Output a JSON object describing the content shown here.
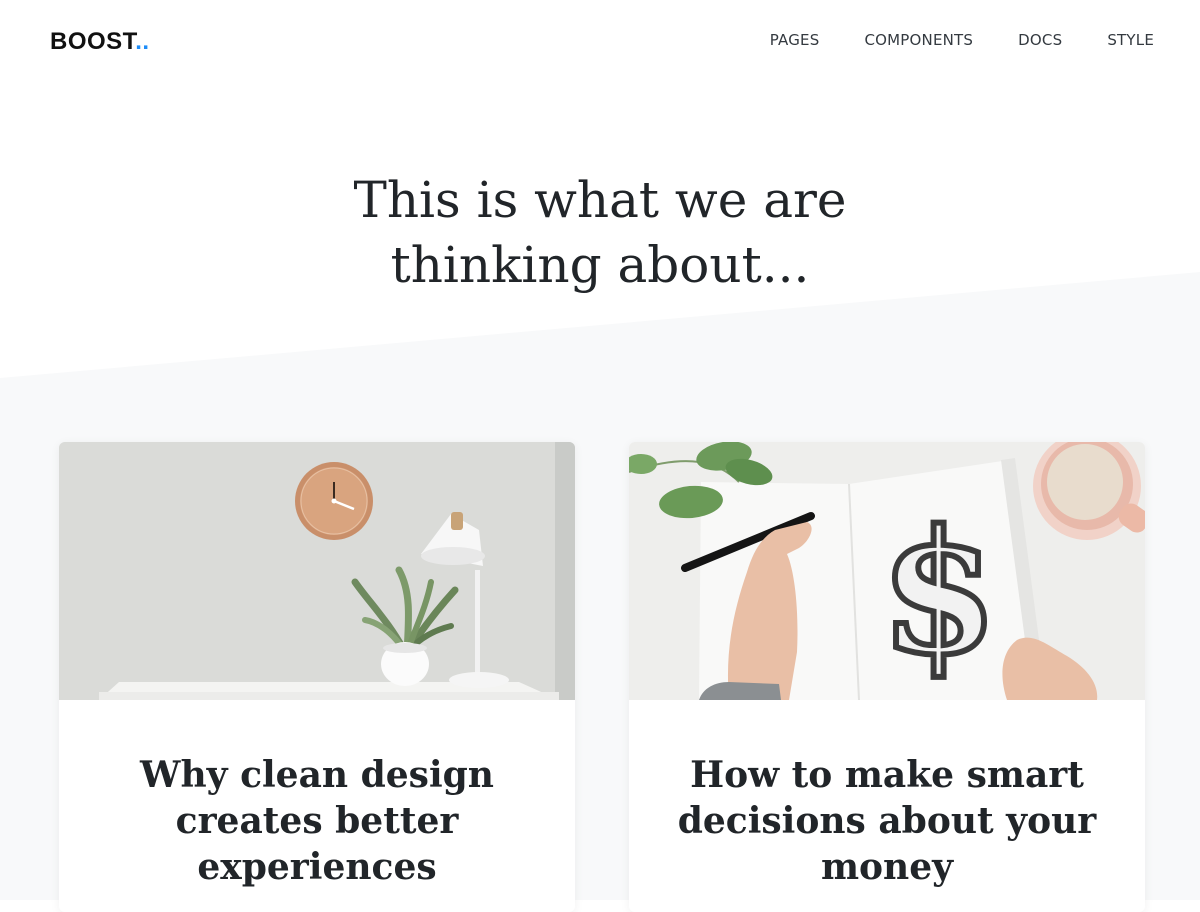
{
  "brand": {
    "name": "BOOST",
    "dots": "..",
    "accent_color": "#1d8cf8"
  },
  "nav": {
    "items": [
      {
        "label": "PAGES"
      },
      {
        "label": "COMPONENTS"
      },
      {
        "label": "DOCS"
      },
      {
        "label": "STYLE"
      }
    ]
  },
  "hero": {
    "title_line1": "This is what we are",
    "title_line2": "thinking about..."
  },
  "posts": [
    {
      "title": "Why clean design creates better experiences",
      "image": "desk-clock-plant-lamp-photo"
    },
    {
      "title": "How to make smart decisions about your money",
      "image": "hand-drawing-dollar-sign-photo"
    }
  ],
  "colors": {
    "section_bg": "#f8f9fa",
    "text": "#212529"
  }
}
